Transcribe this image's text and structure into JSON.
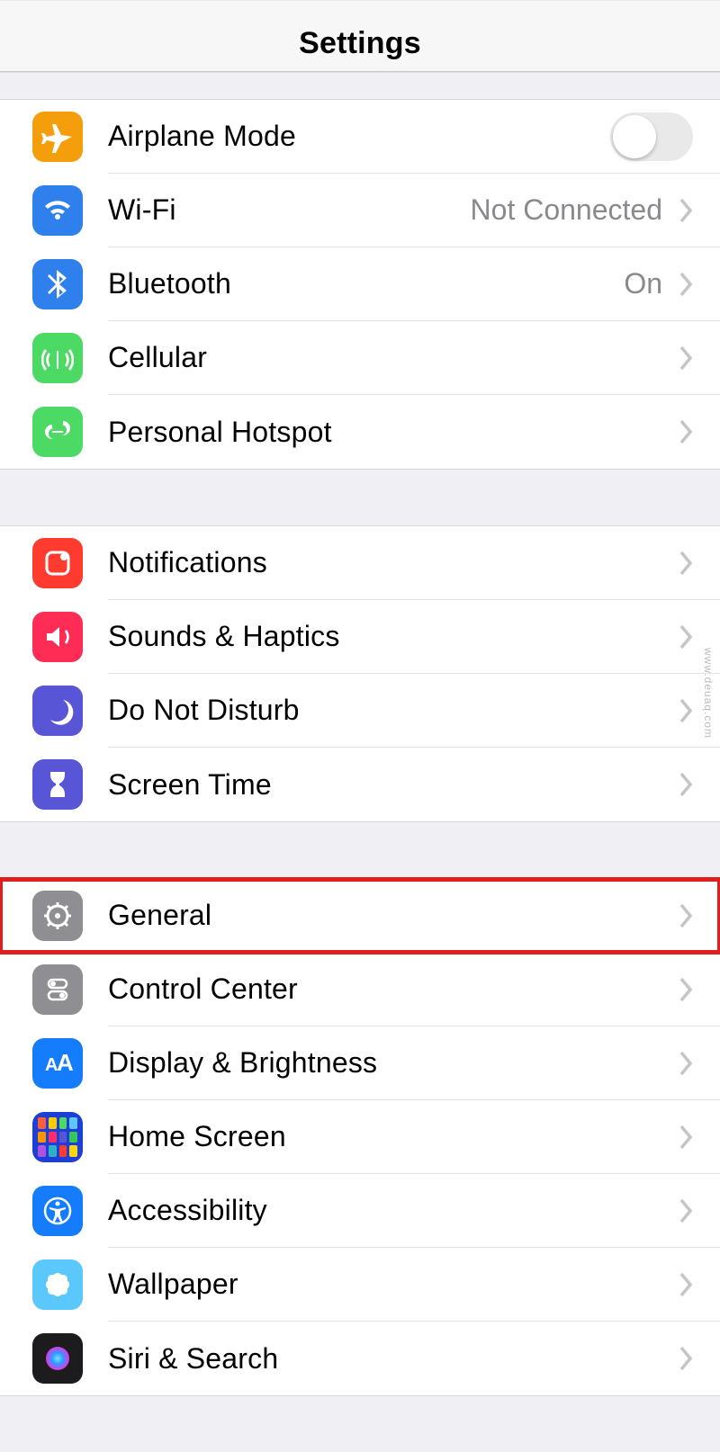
{
  "header": {
    "title": "Settings"
  },
  "groups": [
    {
      "rows": [
        {
          "id": "airplane",
          "label": "Airplane Mode",
          "icon": "airplane-icon",
          "color": "bg-orange",
          "type": "toggle",
          "toggle": false
        },
        {
          "id": "wifi",
          "label": "Wi-Fi",
          "icon": "wifi-icon",
          "color": "bg-blue",
          "type": "link",
          "detail": "Not Connected"
        },
        {
          "id": "bluetooth",
          "label": "Bluetooth",
          "icon": "bluetooth-icon",
          "color": "bg-blue",
          "type": "link",
          "detail": "On"
        },
        {
          "id": "cellular",
          "label": "Cellular",
          "icon": "cellular-icon",
          "color": "bg-green",
          "type": "link"
        },
        {
          "id": "hotspot",
          "label": "Personal Hotspot",
          "icon": "hotspot-icon",
          "color": "bg-green",
          "type": "link"
        }
      ]
    },
    {
      "rows": [
        {
          "id": "notifications",
          "label": "Notifications",
          "icon": "notifications-icon",
          "color": "bg-red",
          "type": "link"
        },
        {
          "id": "sounds",
          "label": "Sounds & Haptics",
          "icon": "sounds-icon",
          "color": "bg-pink",
          "type": "link"
        },
        {
          "id": "dnd",
          "label": "Do Not Disturb",
          "icon": "dnd-icon",
          "color": "bg-indigo",
          "type": "link"
        },
        {
          "id": "screentime",
          "label": "Screen Time",
          "icon": "screentime-icon",
          "color": "bg-indigo",
          "type": "link"
        }
      ]
    },
    {
      "rows": [
        {
          "id": "general",
          "label": "General",
          "icon": "general-icon",
          "color": "bg-gray",
          "type": "link",
          "highlight": true
        },
        {
          "id": "controlcenter",
          "label": "Control Center",
          "icon": "controlcenter-icon",
          "color": "bg-gray",
          "type": "link"
        },
        {
          "id": "display",
          "label": "Display & Brightness",
          "icon": "display-icon",
          "color": "bg-bluea",
          "type": "link"
        },
        {
          "id": "homescreen",
          "label": "Home Screen",
          "icon": "homescreen-icon",
          "color": "bg-bluea",
          "type": "link"
        },
        {
          "id": "accessibility",
          "label": "Accessibility",
          "icon": "accessibility-icon",
          "color": "bg-bluea",
          "type": "link"
        },
        {
          "id": "wallpaper",
          "label": "Wallpaper",
          "icon": "wallpaper-icon",
          "color": "bg-cyan",
          "type": "link"
        },
        {
          "id": "siri",
          "label": "Siri & Search",
          "icon": "siri-icon",
          "color": "bg-dark",
          "type": "link"
        }
      ]
    }
  ],
  "watermark": "www.deuaq.com"
}
